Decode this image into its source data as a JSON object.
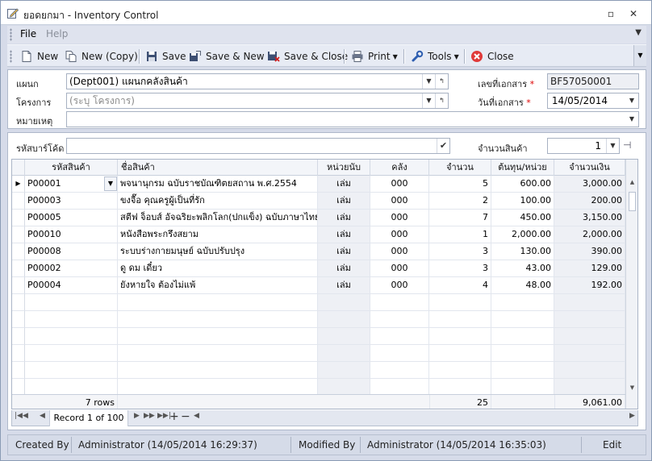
{
  "window": {
    "title": "ยอดยกมา - Inventory Control"
  },
  "menu": {
    "file": "File",
    "help": "Help"
  },
  "toolbar": {
    "new": "New",
    "new_copy": "New (Copy)",
    "save": "Save",
    "save_new": "Save & New",
    "save_close": "Save & Close",
    "print": "Print",
    "tools": "Tools",
    "close": "Close"
  },
  "form": {
    "department_label": "แผนก",
    "department_value": "(Dept001) แผนกคลังสินค้า",
    "project_label": "โครงการ",
    "project_placeholder": "(ระบุ โครงการ)",
    "remark_label": "หมายเหตุ",
    "remark_value": "",
    "doc_no_label": "เลขที่เอกสาร",
    "doc_no_value": "BF57050001",
    "doc_date_label": "วันที่เอกสาร",
    "doc_date_value": "14/05/2014",
    "required_mark": "*"
  },
  "barcode": {
    "label": "รหัสบาร์โค้ด",
    "value": "",
    "qty_label": "จำนวนสินค้า",
    "qty_value": "1"
  },
  "grid": {
    "headers": [
      "รหัสสินค้า",
      "ชื่อสินค้า",
      "หน่วยนับ",
      "คลัง",
      "จำนวน",
      "ต้นทุน/หน่วย",
      "จำนวนเงิน"
    ],
    "rows": [
      {
        "code": "P00001",
        "name": "พจนานุกรม ฉบับราชบัณฑิตยสถาน พ.ศ.2554",
        "unit": "เล่ม",
        "wh": "000",
        "qty": "5",
        "cost": "600.00",
        "amount": "3,000.00"
      },
      {
        "code": "P00003",
        "name": "ขงจื๊อ คุณครูผู้เป็นที่รัก",
        "unit": "เล่ม",
        "wh": "000",
        "qty": "2",
        "cost": "100.00",
        "amount": "200.00"
      },
      {
        "code": "P00005",
        "name": "สตีฟ จ็อบส์ อัจฉริยะพลิกโลก(ปกแข็ง) ฉบับภาษาไทย",
        "unit": "เล่ม",
        "wh": "000",
        "qty": "7",
        "cost": "450.00",
        "amount": "3,150.00"
      },
      {
        "code": "P00010",
        "name": "หนังสือพระกรึงสยาม",
        "unit": "เล่ม",
        "wh": "000",
        "qty": "1",
        "cost": "2,000.00",
        "amount": "2,000.00"
      },
      {
        "code": "P00008",
        "name": "ระบบร่างกายมนุษย์ ฉบับปรับปรุง",
        "unit": "เล่ม",
        "wh": "000",
        "qty": "3",
        "cost": "130.00",
        "amount": "390.00"
      },
      {
        "code": "P00002",
        "name": "ดู ดม เดี๋ยว",
        "unit": "เล่ม",
        "wh": "000",
        "qty": "3",
        "cost": "43.00",
        "amount": "129.00"
      },
      {
        "code": "P00004",
        "name": "ยังหายใจ ต้องไม่แพ้",
        "unit": "เล่ม",
        "wh": "000",
        "qty": "4",
        "cost": "48.00",
        "amount": "192.00"
      }
    ],
    "footer": {
      "rows": "7 rows",
      "qty_total": "25",
      "amount_total": "9,061.00"
    }
  },
  "navigator": {
    "record": "Record 1 of 100"
  },
  "status": {
    "created_by_label": "Created By",
    "created_by_value": "Administrator (14/05/2014 16:29:37)",
    "modified_by_label": "Modified By",
    "modified_by_value": "Administrator (14/05/2014 16:35:03)",
    "mode": "Edit"
  }
}
